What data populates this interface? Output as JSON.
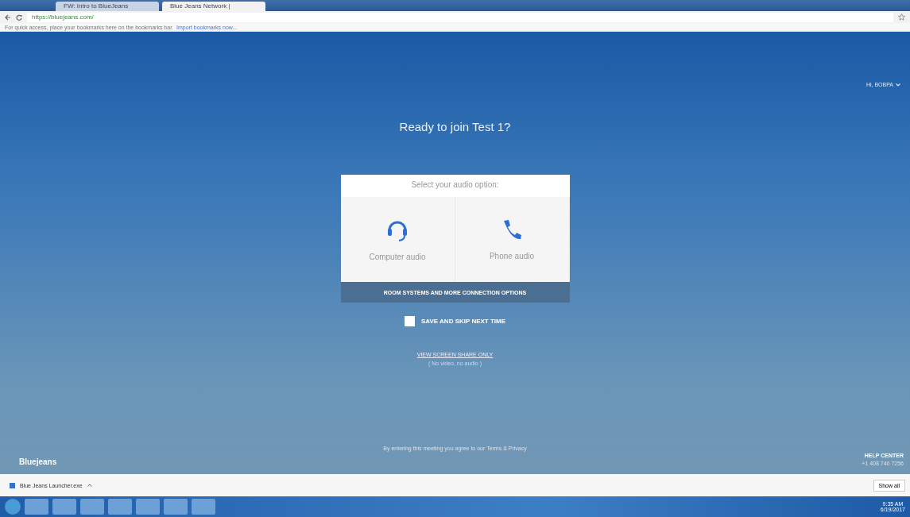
{
  "browser": {
    "tabs": [
      {
        "title": "FW: Intro to BlueJeans",
        "selected": false
      },
      {
        "title": "Blue Jeans Network |",
        "selected": true
      }
    ],
    "url": "https://bluejeans.com/",
    "bookmarks_hint": "For quick access, place your bookmarks here on the bookmarks bar.",
    "bookmarks_link": "Import bookmarks now..."
  },
  "page": {
    "user_menu": "Hi, BOBPA",
    "title": "Ready to join Test 1?",
    "audio_prompt": "Select your audio option:",
    "audio_options": [
      {
        "kind": "headset",
        "label": "Computer audio"
      },
      {
        "kind": "phone",
        "label": "Phone audio"
      }
    ],
    "more_options": "ROOM SYSTEMS AND MORE CONNECTION OPTIONS",
    "save_skip": {
      "label": "SAVE AND SKIP NEXT TIME",
      "checked": false
    },
    "screen_share_link": "VIEW SCREEN SHARE ONLY",
    "screen_share_note": "( No video, no audio )",
    "legal": "By entering this meeting you agree to our Terms & Privacy",
    "brand": "Bluejeans",
    "help_title": "HELP CENTER",
    "help_phone": "+1 408 740 7256"
  },
  "download_bar": {
    "file": "Blue Jeans Launcher.exe",
    "show_all": "Show all"
  },
  "taskbar": {
    "time": "9:35 AM",
    "date": "6/19/2017"
  }
}
